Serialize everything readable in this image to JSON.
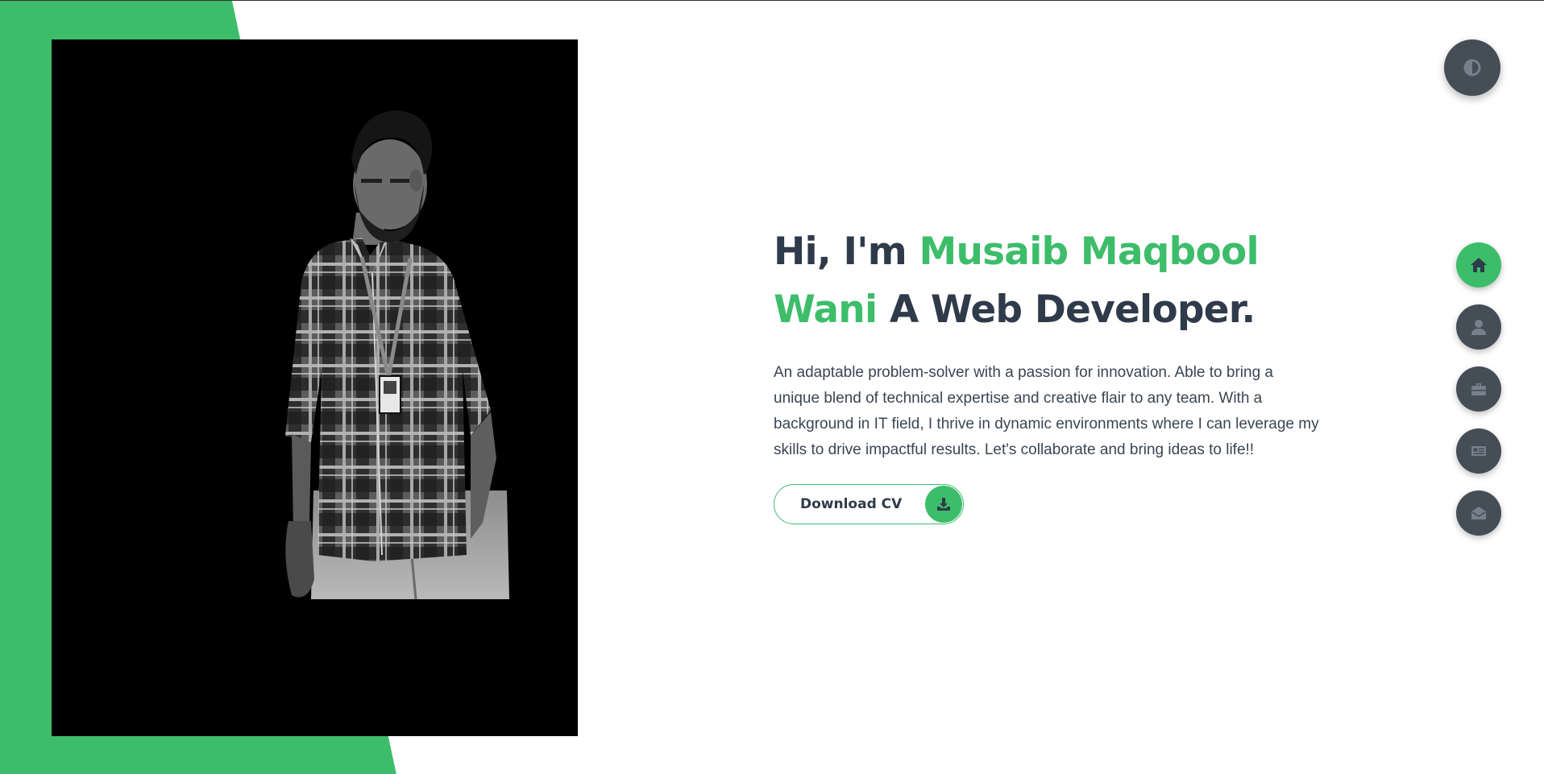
{
  "hero": {
    "greeting": "Hi, I'm ",
    "name_line1": "Musaib Maqbool",
    "name_line2": "Wani",
    "role": " A Web Developer.",
    "intro": "An adaptable problem-solver with a passion for innovation. Able to bring a unique blend of technical expertise and creative flair to any team. With a background in IT field, I thrive in dynamic environments where I can leverage my skills to drive impactful results. Let's collaborate and bring ideas to life!!",
    "cv_button_label": "Download CV",
    "cv_button_icon": "download-icon",
    "photo": "portrait-photo"
  },
  "theme_toggle": {
    "icon": "contrast-icon"
  },
  "nav": {
    "items": [
      {
        "id": "home",
        "icon": "home-icon",
        "active": true
      },
      {
        "id": "about",
        "icon": "user-icon",
        "active": false
      },
      {
        "id": "portfolio",
        "icon": "briefcase-icon",
        "active": false
      },
      {
        "id": "blog",
        "icon": "newspaper-icon",
        "active": false
      },
      {
        "id": "contact",
        "icon": "envelope-open-icon",
        "active": false
      }
    ]
  },
  "colors": {
    "accent": "#3dbd6a",
    "dark": "#2f3b4a",
    "button_gray": "#454d57",
    "icon_gray": "#77808b",
    "background": "#ffffff",
    "photo_background": "#000000"
  }
}
